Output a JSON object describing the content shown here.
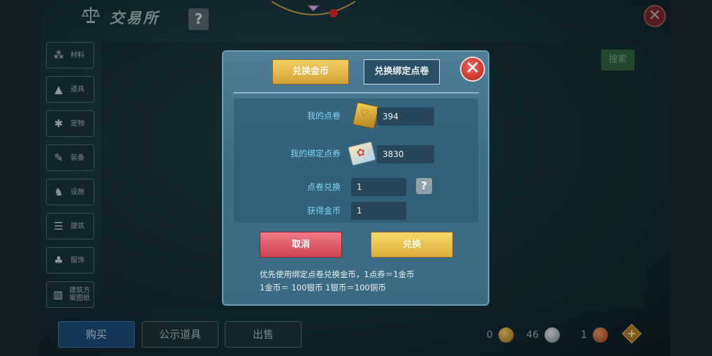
{
  "header": {
    "title": "交易所",
    "help_label": "?"
  },
  "sidebar": {
    "items": [
      {
        "label": "材料",
        "icon": "materials-icon"
      },
      {
        "label": "道具",
        "icon": "items-icon"
      },
      {
        "label": "宠物",
        "icon": "pet-paw-icon"
      },
      {
        "label": "装备",
        "icon": "equipment-icon"
      },
      {
        "label": "设施",
        "icon": "facility-icon"
      },
      {
        "label": "建筑",
        "icon": "building-icon"
      },
      {
        "label": "服饰",
        "icon": "clothing-icon"
      },
      {
        "label": "建筑方案图纸",
        "icon": "blueprint-icon"
      }
    ]
  },
  "search": {
    "button_label": "搜索"
  },
  "bottom_tabs": [
    "购买",
    "公示道具",
    "出售"
  ],
  "currency": {
    "gold": "0",
    "silver": "46",
    "copper": "1"
  },
  "dialog": {
    "tab_gold": "兑换金币",
    "tab_bound": "兑换绑定点卷",
    "my_points_label": "我的点卷",
    "my_points_value": "394",
    "my_bound_label": "我的绑定点券",
    "my_bound_value": "3830",
    "exchange_label": "点卷兑换",
    "exchange_value": "1",
    "gain_label": "获得金币",
    "gain_value": "1",
    "cancel_label": "取消",
    "confirm_label": "兑换",
    "note_line1": "优先使用绑定点卷兑换金币，1点券＝1金币",
    "note_line2": "1金币＝ 100银币  1银币＝100铜币"
  },
  "colors": {
    "accent_gold": "#d4a43a",
    "cancel_red": "#cf4253",
    "label_cyan": "#7fd6f2",
    "dialog_bg": "#3f6e86"
  }
}
